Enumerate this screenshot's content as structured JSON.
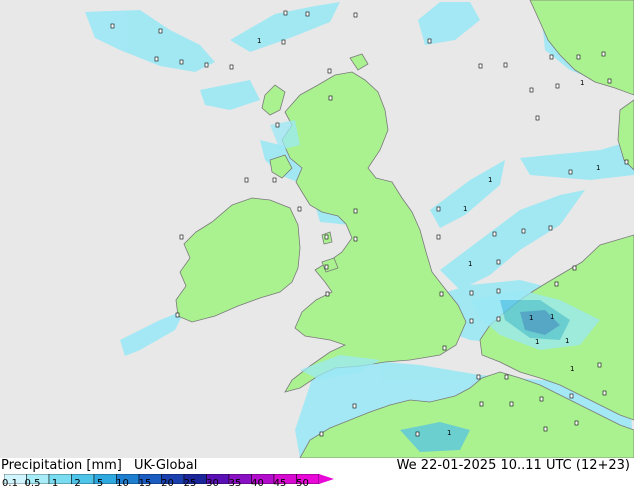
{
  "map": {
    "colors": {
      "sea": "#e8e8e8",
      "land": "#aaf28f",
      "coast": "#7a7a7a",
      "rain_light": "#9be8f5",
      "rain_mid": "#55c3e6",
      "rain_heavy": "#3a8fd8"
    },
    "value_labels": [
      "1",
      "1",
      "1",
      "1",
      "1",
      "1",
      "1",
      "1",
      "1",
      "1",
      "1",
      "1"
    ]
  },
  "footer": {
    "title": "Precipitation [mm]",
    "model": "UK-Global",
    "datetime": "We 22-01-2025 10..11 UTC (12+23)"
  },
  "legend": {
    "ticks": [
      "0.1",
      "0.5",
      "1",
      "2",
      "5",
      "10",
      "15",
      "20",
      "25",
      "30",
      "35",
      "40",
      "45",
      "50"
    ],
    "colors": [
      "#d0f5ff",
      "#a8ecf8",
      "#7adcf0",
      "#4ec4e8",
      "#2fa8e0",
      "#1e7fd0",
      "#1a5cc0",
      "#1a3fae",
      "#1a259a",
      "#5a10b4",
      "#8a10c4",
      "#b40ccc",
      "#d60ad0",
      "#e808d8"
    ]
  }
}
